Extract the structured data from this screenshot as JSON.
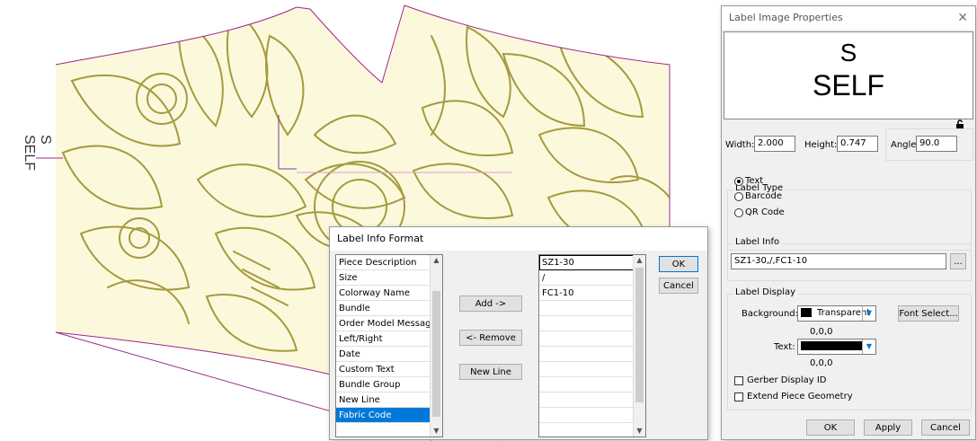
{
  "canvas": {
    "side_label_size": "S",
    "side_label_piece": "SELF"
  },
  "info_dialog": {
    "title": "Label Info Format",
    "available_items": [
      "Piece Description",
      "Size",
      "Colorway Name",
      "Bundle",
      "Order Model Message",
      "Left/Right",
      "Date",
      "Custom Text",
      "Bundle Group",
      "New Line",
      "Fabric Code"
    ],
    "selected_item": "Fabric Code",
    "add_label": "Add ->",
    "remove_label": "<- Remove",
    "newline_label": "New Line",
    "format_rows": [
      "SZ1-30",
      "/",
      "FC1-10",
      "",
      "",
      "",
      "",
      "",
      "",
      "",
      "",
      ""
    ],
    "ok_label": "OK",
    "cancel_label": "Cancel"
  },
  "props_dialog": {
    "title": "Label Image Properties",
    "preview_line1": "S",
    "preview_line2": "SELF",
    "width_label": "Width:",
    "width_value": "2.000",
    "height_label": "Height:",
    "height_value": "0.747",
    "angle_label": "Angle:",
    "angle_value": "90.0",
    "label_type_title": "Label Type",
    "type_text": "Text",
    "type_barcode": "Barcode",
    "type_qr": "QR Code",
    "label_info_title": "Label Info",
    "label_info_value": "SZ1-30,/,FC1-10",
    "browse_label": "...",
    "label_display_title": "Label Display",
    "background_label": "Background:",
    "background_value": "Transparent",
    "background_rgb": "0,0,0",
    "font_select_label": "Font Select...",
    "text_label": "Text:",
    "text_rgb": "0,0,0",
    "gerber_display_id": "Gerber Display ID",
    "extend_piece_geometry": "Extend Piece Geometry",
    "ok_label": "OK",
    "apply_label": "Apply",
    "cancel_label": "Cancel"
  },
  "colors": {
    "fabric": "#fcf8dc",
    "flower_line": "#a59a3c",
    "piece_outline": "#a0268c",
    "selection_blue": "#0078d7"
  }
}
